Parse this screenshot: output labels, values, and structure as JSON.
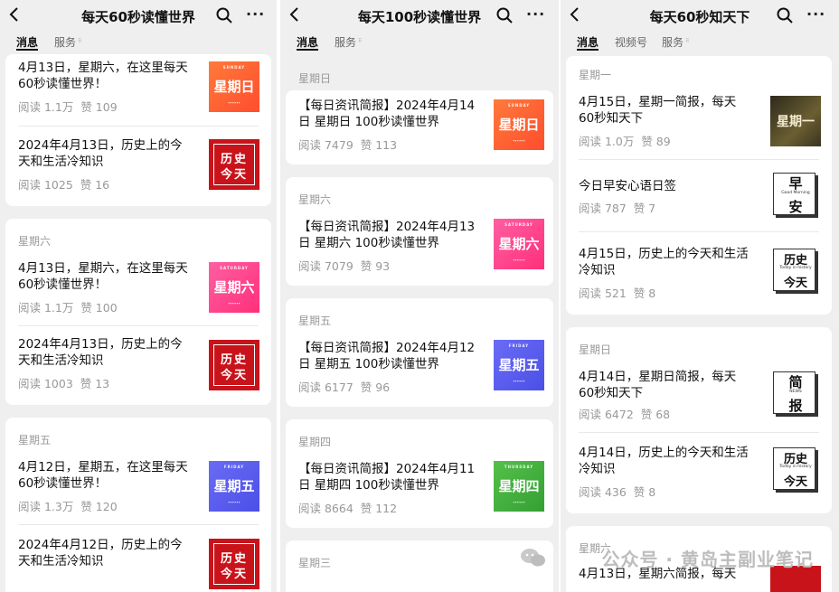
{
  "panels": [
    {
      "title": "每天60秒读懂世界",
      "tabs": [
        "消息",
        "服务"
      ],
      "items": [
        {
          "title_lines": [
            "4月13日，星期六，在这里每天",
            "60秒读懂世界！"
          ],
          "reads": "阅读 1.1万",
          "likes": "赞 109",
          "thumb_big": "星期日",
          "thumb_en": "SUNDAY"
        },
        {
          "title_lines": [
            "2024年4月13日，历史上的今",
            "天和生活冷知识"
          ],
          "reads": "阅读 1025",
          "likes": "赞 16",
          "thumb_t1": "历史",
          "thumb_t2": "今天"
        },
        {
          "day": "星期六"
        },
        {
          "title_lines": [
            "4月13日，星期六，在这里每天",
            "60秒读懂世界！"
          ],
          "reads": "阅读 1.1万",
          "likes": "赞 100",
          "thumb_big": "星期六",
          "thumb_en": "SATURDAY"
        },
        {
          "title_lines": [
            "2024年4月13日，历史上的今",
            "天和生活冷知识"
          ],
          "reads": "阅读 1003",
          "likes": "赞 13",
          "thumb_t1": "历史",
          "thumb_t2": "今天"
        },
        {
          "day": "星期五"
        },
        {
          "title_lines": [
            "4月12日，星期五，在这里每天",
            "60秒读懂世界！"
          ],
          "reads": "阅读 1.3万",
          "likes": "赞 120",
          "thumb_big": "星期五",
          "thumb_en": "FRIDAY"
        },
        {
          "title_lines": [
            "2024年4月12日，历史上的今",
            "天和生活冷知识"
          ],
          "thumb_t1": "历史",
          "thumb_t2": "今天"
        }
      ]
    },
    {
      "title": "每天100秒读懂世界",
      "tabs": [
        "消息",
        "服务"
      ],
      "items": [
        {
          "day": "星期日"
        },
        {
          "title_lines": [
            "【每日资讯简报】2024年4月14",
            "日 星期日 100秒读懂世界"
          ],
          "reads": "阅读 7479",
          "likes": "赞 113",
          "thumb_big": "星期日",
          "thumb_en": "SUNDAY"
        },
        {
          "day": "星期六"
        },
        {
          "title_lines": [
            "【每日资讯简报】2024年4月13",
            "日 星期六 100秒读懂世界"
          ],
          "reads": "阅读 7079",
          "likes": "赞 93",
          "thumb_big": "星期六",
          "thumb_en": "SATURDAY"
        },
        {
          "day": "星期五"
        },
        {
          "title_lines": [
            "【每日资讯简报】2024年4月12",
            "日 星期五 100秒读懂世界"
          ],
          "reads": "阅读 6177",
          "likes": "赞 96",
          "thumb_big": "星期五",
          "thumb_en": "FRIDAY"
        },
        {
          "day": "星期四"
        },
        {
          "title_lines": [
            "【每日资讯简报】2024年4月11",
            "日 星期四 100秒读懂世界"
          ],
          "reads": "阅读 8664",
          "likes": "赞 112",
          "thumb_big": "星期四",
          "thumb_en": "THURSDAY"
        },
        {
          "day": "星期三"
        }
      ]
    },
    {
      "title": "每天60秒知天下",
      "tabs": [
        "消息",
        "视频号",
        "服务"
      ],
      "items": [
        {
          "day": "星期一"
        },
        {
          "title_lines": [
            "4月15日，星期一简报，每天",
            "60秒知天下"
          ],
          "reads": "阅读 1.0万",
          "likes": "赞 89",
          "thumb_big": "星期一"
        },
        {
          "title_lines": [
            "今日早安心语日签"
          ],
          "reads": "阅读 787",
          "likes": "赞 7",
          "thumb_c1": "早",
          "thumb_c2": "安",
          "thumb_mini": "Good Morning"
        },
        {
          "title_lines": [
            "4月15日，历史上的今天和生活",
            "冷知识"
          ],
          "reads": "阅读 521",
          "likes": "赞 8",
          "thumb_c1": "历史",
          "thumb_c2": "今天",
          "thumb_mini": "Today in history"
        },
        {
          "day": "星期日"
        },
        {
          "title_lines": [
            "4月14日，星期日简报，每天",
            "60秒知天下"
          ],
          "reads": "阅读 6472",
          "likes": "赞 68",
          "thumb_c1": "简",
          "thumb_c2": "报",
          "thumb_mini": "NEWS"
        },
        {
          "title_lines": [
            "4月14日，历史上的今天和生活",
            "冷知识"
          ],
          "reads": "阅读 436",
          "likes": "赞 8",
          "thumb_c1": "历史",
          "thumb_c2": "今天",
          "thumb_mini": "Today in history"
        },
        {
          "day": "星期六"
        },
        {
          "title_lines": [
            "4月13日，星期六简报，每天"
          ]
        }
      ]
    }
  ],
  "watermark": "公众号 · 黄岛主副业笔记",
  "icons": {
    "back": "chevron-left-icon",
    "search": "search-icon",
    "more": "more-dots-icon"
  },
  "more_glyph": "···",
  "colors": {
    "bg": "#efefef",
    "card": "#ffffff",
    "history_red": "#c8131a",
    "sunday": "#ff5a36",
    "saturday": "#ff3d8b",
    "friday": "#5b5ef0",
    "thursday": "#3fae3a"
  }
}
